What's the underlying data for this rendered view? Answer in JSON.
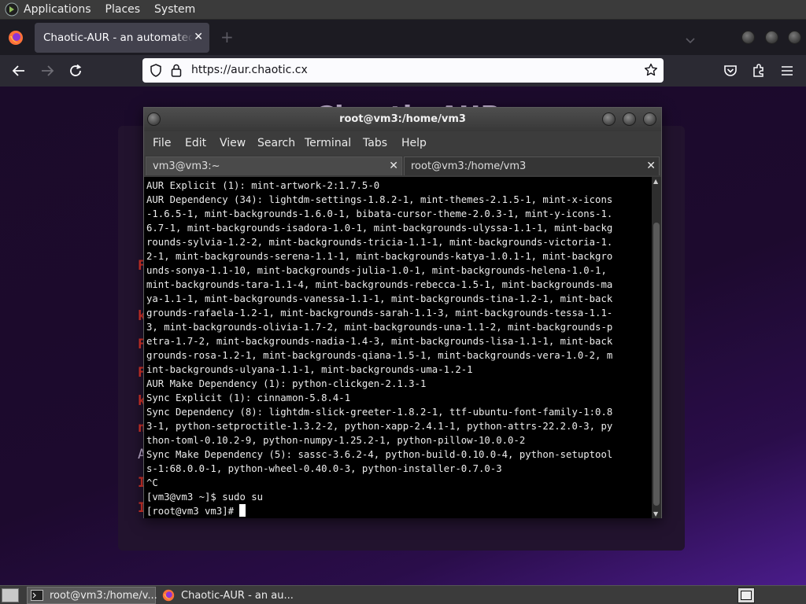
{
  "top_panel": {
    "menus": [
      "Applications",
      "Places",
      "System"
    ]
  },
  "browser": {
    "tab_title": "Chaotic-AUR - an automated bu",
    "url": "https://aur.chaotic.cx",
    "page_heading": "Chaotic-AUR",
    "background_glyphs": [
      "F",
      "k",
      "F",
      "F",
      "k",
      "n",
      "A",
      "I",
      "I"
    ]
  },
  "terminal": {
    "window_title": "root@vm3:/home/vm3",
    "menu": [
      "File",
      "Edit",
      "View",
      "Search",
      "Terminal",
      "Tabs",
      "Help"
    ],
    "tabs": [
      {
        "label": "vm3@vm3:~"
      },
      {
        "label": "root@vm3:/home/vm3"
      }
    ],
    "lines": [
      "AUR Explicit (1): mint-artwork-2:1.7.5-0",
      "AUR Dependency (34): lightdm-settings-1.8.2-1, mint-themes-2.1.5-1, mint-x-icons",
      "-1.6.5-1, mint-backgrounds-1.6.0-1, bibata-cursor-theme-2.0.3-1, mint-y-icons-1.",
      "6.7-1, mint-backgrounds-isadora-1.0-1, mint-backgrounds-ulyssa-1.1-1, mint-backg",
      "rounds-sylvia-1.2-2, mint-backgrounds-tricia-1.1-1, mint-backgrounds-victoria-1.",
      "2-1, mint-backgrounds-serena-1.1-1, mint-backgrounds-katya-1.0.1-1, mint-backgro",
      "unds-sonya-1.1-10, mint-backgrounds-julia-1.0-1, mint-backgrounds-helena-1.0-1,",
      "mint-backgrounds-tara-1.1-4, mint-backgrounds-rebecca-1.5-1, mint-backgrounds-ma",
      "ya-1.1-1, mint-backgrounds-vanessa-1.1-1, mint-backgrounds-tina-1.2-1, mint-back",
      "grounds-rafaela-1.2-1, mint-backgrounds-sarah-1.1-3, mint-backgrounds-tessa-1.1-",
      "3, mint-backgrounds-olivia-1.7-2, mint-backgrounds-una-1.1-2, mint-backgrounds-p",
      "etra-1.7-2, mint-backgrounds-nadia-1.4-3, mint-backgrounds-lisa-1.1-1, mint-back",
      "grounds-rosa-1.2-1, mint-backgrounds-qiana-1.5-1, mint-backgrounds-vera-1.0-2, m",
      "int-backgrounds-ulyana-1.1-1, mint-backgrounds-uma-1.2-1",
      "AUR Make Dependency (1): python-clickgen-2.1.3-1",
      "Sync Explicit (1): cinnamon-5.8.4-1",
      "Sync Dependency (8): lightdm-slick-greeter-1.8.2-1, ttf-ubuntu-font-family-1:0.8",
      "3-1, python-setproctitle-1.3.2-2, python-xapp-2.4.1-1, python-attrs-22.2.0-3, py",
      "thon-toml-0.10.2-9, python-numpy-1.25.2-1, python-pillow-10.0.0-2",
      "Sync Make Dependency (5): sassc-3.6.2-4, python-build-0.10.0-4, python-setuptool",
      "s-1:68.0.0-1, python-wheel-0.40.0-3, python-installer-0.7.0-3",
      "^C",
      "[vm3@vm3 ~]$ sudo su"
    ],
    "prompt": "[root@vm3 vm3]# "
  },
  "taskbar": {
    "items": [
      {
        "label": "root@vm3:/home/v...",
        "icon": "terminal-icon"
      },
      {
        "label": "Chaotic-AUR - an au...",
        "icon": "firefox-icon"
      }
    ]
  }
}
